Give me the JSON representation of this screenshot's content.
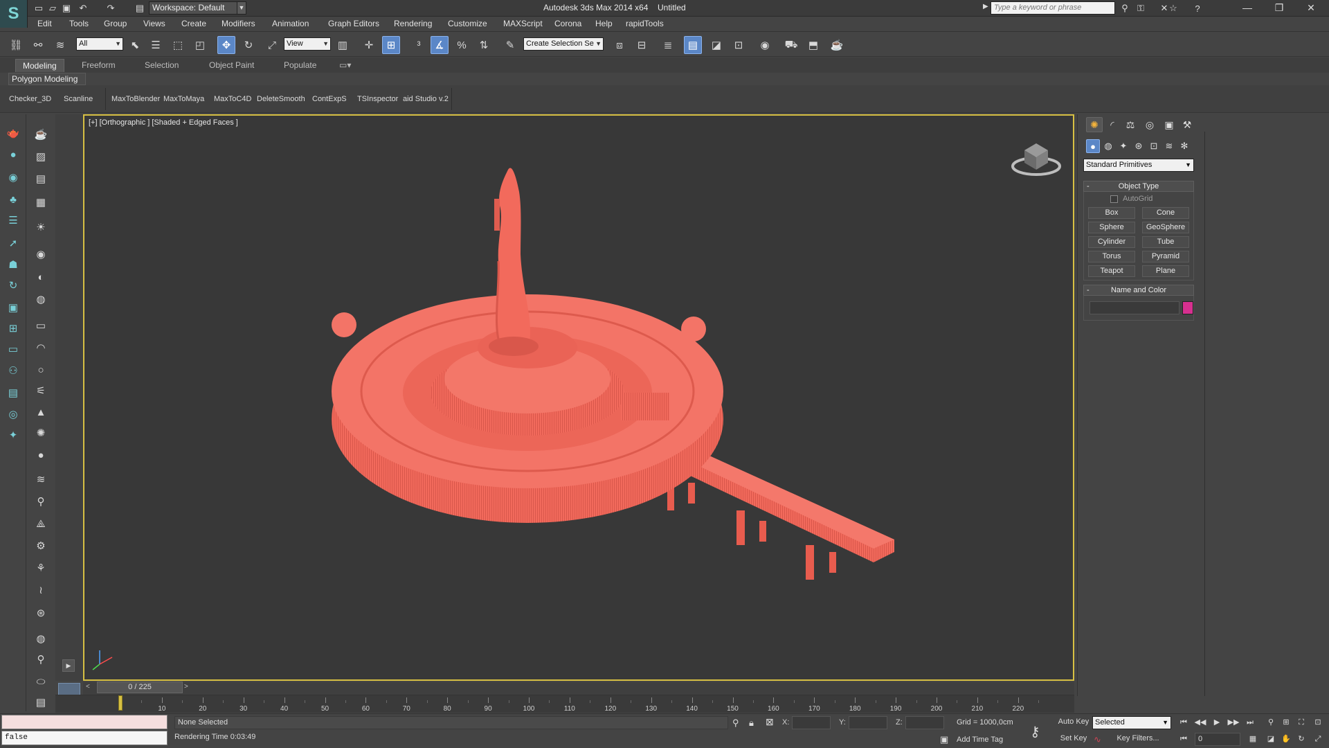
{
  "title_bar": {
    "workspace": "Workspace: Default",
    "app_title": "Autodesk 3ds Max  2014 x64",
    "doc_title": "Untitled",
    "search_placeholder": "Type a keyword or phrase"
  },
  "menu": [
    "Edit",
    "Tools",
    "Group",
    "Views",
    "Create",
    "Modifiers",
    "Animation",
    "Graph Editors",
    "Rendering",
    "Customize",
    "MAXScript",
    "Corona",
    "Help",
    "rapidTools"
  ],
  "toolbar": {
    "filter_select": "All",
    "ref_coord_select": "View",
    "named_selection_set": "Create Selection Se"
  },
  "ribbon": {
    "tabs": [
      "Modeling",
      "Freeform",
      "Selection",
      "Object Paint",
      "Populate"
    ],
    "active_panel": "Polygon Modeling"
  },
  "shelf": [
    "Checker_3D",
    "Scanline",
    "MaxToBlender",
    "MaxToMaya",
    "MaxToC4D",
    "DeleteSmooth",
    "ContExpS",
    "TSInspector",
    "aid Studio v.2"
  ],
  "viewport": {
    "label": "[+] [Orthographic ] [Shaded + Edged Faces ]",
    "model_color": "#f26a5c"
  },
  "command_panel": {
    "category": "Standard Primitives",
    "object_type_title": "Object Type",
    "autogrid": "AutoGrid",
    "primitives": [
      "Box",
      "Cone",
      "Sphere",
      "GeoSphere",
      "Cylinder",
      "Tube",
      "Torus",
      "Pyramid",
      "Teapot",
      "Plane"
    ],
    "name_color_title": "Name and Color",
    "color_swatch": "#d6308f"
  },
  "timeline": {
    "frame_display": "0 / 225",
    "ticks": [
      10,
      20,
      30,
      40,
      50,
      60,
      70,
      80,
      90,
      100,
      110,
      120,
      130,
      140,
      150,
      160,
      170,
      180,
      190,
      200,
      210,
      220
    ]
  },
  "status": {
    "maxscript_output": "false",
    "selection": "None Selected",
    "render_time": "Rendering Time  0:03:49",
    "x_label": "X:",
    "y_label": "Y:",
    "z_label": "Z:",
    "grid": "Grid = 1000,0cm",
    "add_time_tag": "Add Time Tag",
    "auto_key": "Auto Key",
    "set_key": "Set Key",
    "key_mode": "Selected",
    "key_filters": "Key Filters...",
    "current_frame": "0"
  }
}
